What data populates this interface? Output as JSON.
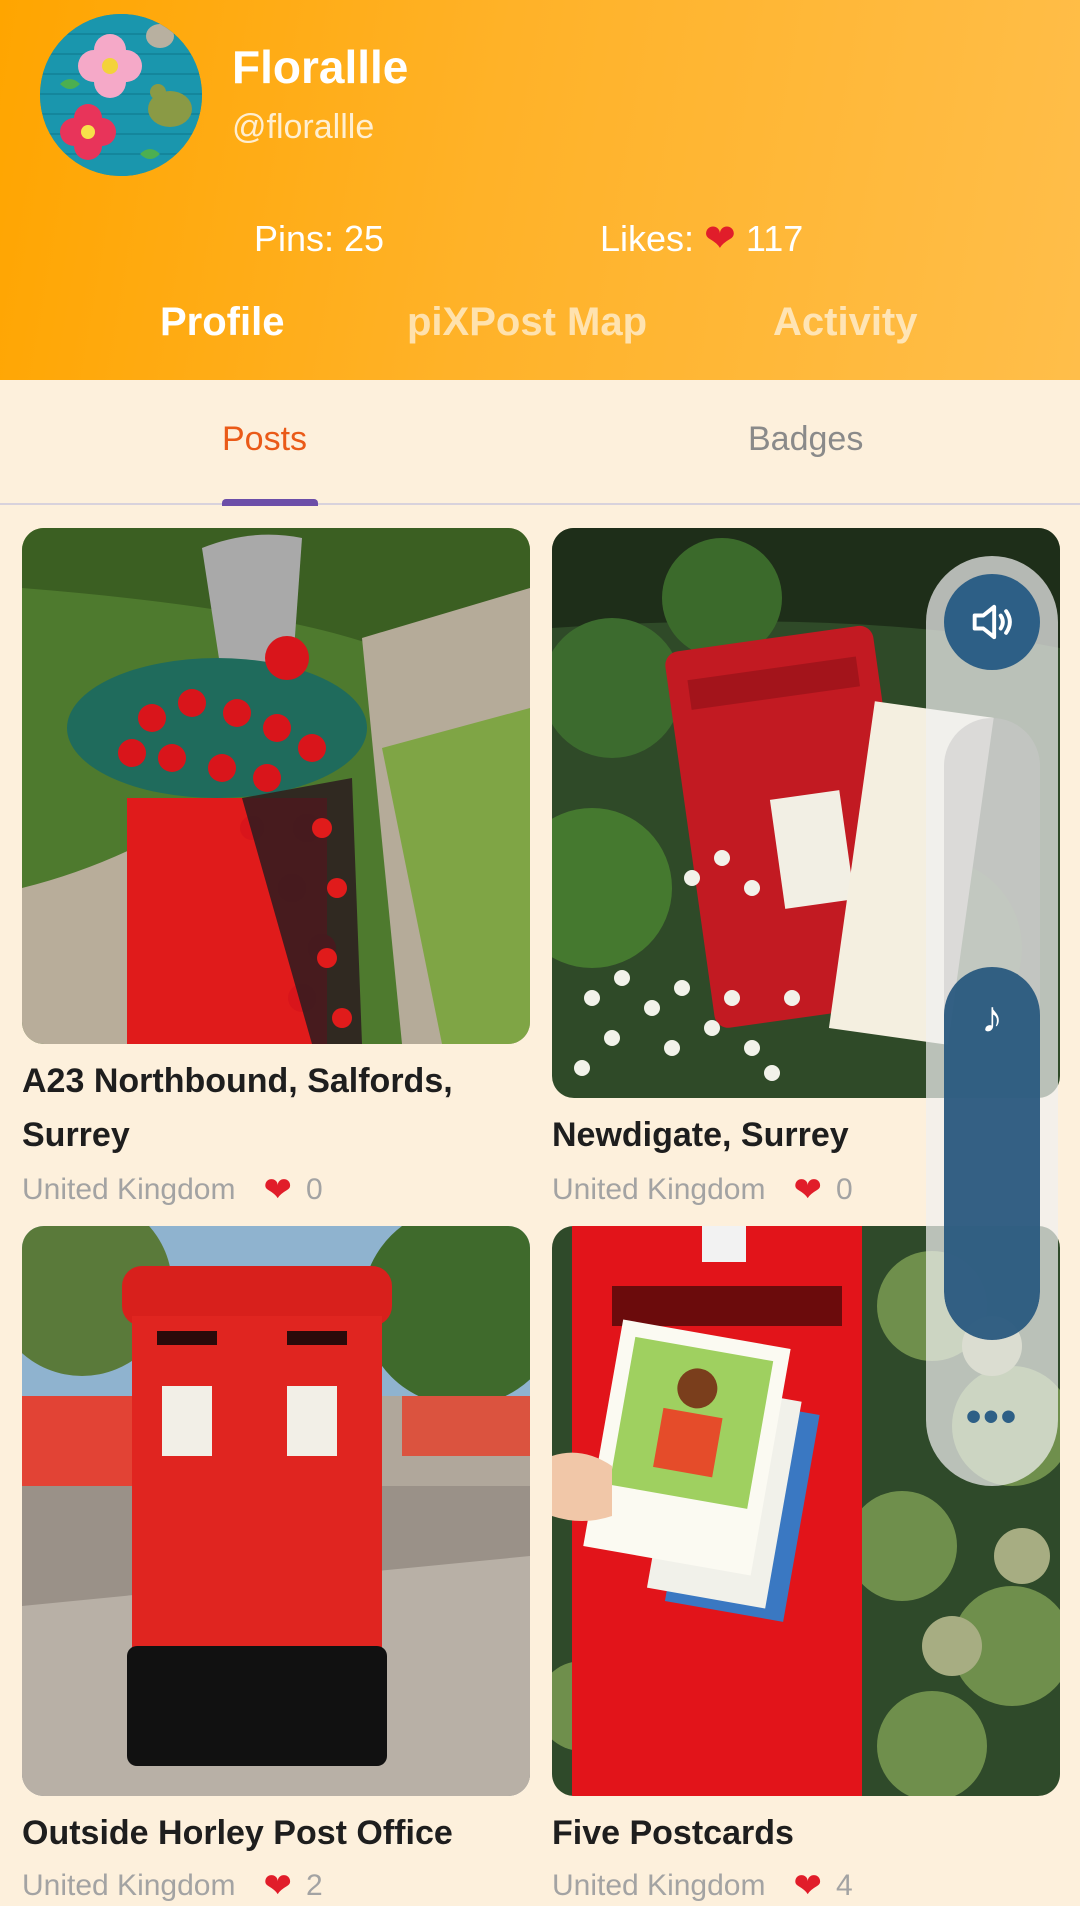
{
  "profile": {
    "name": "Florallle",
    "handle": "@florallle",
    "pins_label": "Pins: 25",
    "likes_label": "Likes:",
    "likes_count": "117"
  },
  "top_tabs": [
    {
      "label": "Profile",
      "active": true
    },
    {
      "label": "piXPost Map",
      "active": false
    },
    {
      "label": "Activity",
      "active": false
    }
  ],
  "sub_tabs": [
    {
      "label": "Posts",
      "active": true
    },
    {
      "label": "Badges",
      "active": false
    }
  ],
  "posts": [
    {
      "title_line1": "A23 Northbound, Salfords,",
      "title_line2": "Surrey",
      "country": "United Kingdom",
      "likes": "0",
      "photo_icon": "yarn-bombed-postbox-photo"
    },
    {
      "title_line1": "Newdigate, Surrey",
      "title_line2": "",
      "country": "United Kingdom",
      "likes": "0",
      "photo_icon": "wall-postbox-photo"
    },
    {
      "title_line1": "Outside Horley Post Office",
      "title_line2": "",
      "country": "United Kingdom",
      "likes": "2",
      "photo_icon": "pillar-box-photo"
    },
    {
      "title_line1": "Five Postcards",
      "title_line2": "",
      "country": "United Kingdom",
      "likes": "4",
      "photo_icon": "postcards-photo"
    }
  ],
  "volume_panel": {
    "level": 0.6,
    "speaker_icon": "speaker-icon",
    "media_icon": "music-note-icon",
    "more_label": "•••"
  },
  "colors": {
    "header_start": "#ffa500",
    "header_end": "#ffbe4a",
    "accent": "#ea5a18",
    "indicator": "#6c4ea8",
    "heart": "#e11d2a",
    "volume": "#2d5f86"
  }
}
